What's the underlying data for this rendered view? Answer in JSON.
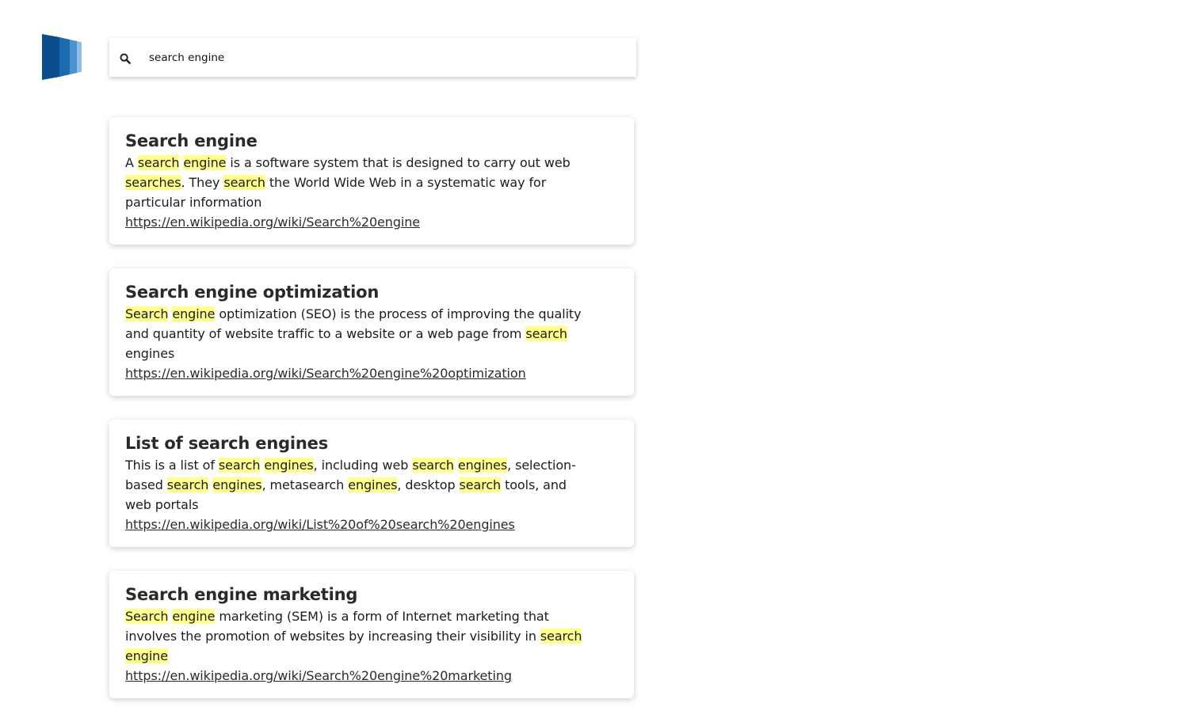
{
  "search": {
    "query": "search engine",
    "icon": "search-icon"
  },
  "logo": {
    "icon": "logo-icon",
    "colors": [
      "#0a4f8c",
      "#1b6bb0",
      "#4d92cc",
      "#8fbfe6"
    ]
  },
  "highlight_color": "#ffff8a",
  "results": [
    {
      "title": "Search engine",
      "snippet": [
        {
          "t": "A ",
          "h": false
        },
        {
          "t": "search",
          "h": true
        },
        {
          "t": " ",
          "h": false
        },
        {
          "t": "engine",
          "h": true
        },
        {
          "t": " is a software system that is designed to carry out web ",
          "h": false
        },
        {
          "t": "searches",
          "h": true
        },
        {
          "t": ". They ",
          "h": false
        },
        {
          "t": "search",
          "h": true
        },
        {
          "t": " the World Wide Web in a systematic way for particular information",
          "h": false
        }
      ],
      "url": "https://en.wikipedia.org/wiki/Search%20engine"
    },
    {
      "title": "Search engine optimization",
      "snippet": [
        {
          "t": "Search",
          "h": true
        },
        {
          "t": " ",
          "h": false
        },
        {
          "t": "engine",
          "h": true
        },
        {
          "t": " optimization (SEO) is the process of improving the quality and quantity of website traffic to a website or a web page from ",
          "h": false
        },
        {
          "t": "search",
          "h": true
        },
        {
          "t": " engines",
          "h": false
        }
      ],
      "url": "https://en.wikipedia.org/wiki/Search%20engine%20optimization"
    },
    {
      "title": "List of search engines",
      "snippet": [
        {
          "t": "This is a list of ",
          "h": false
        },
        {
          "t": "search",
          "h": true
        },
        {
          "t": " ",
          "h": false
        },
        {
          "t": "engines",
          "h": true
        },
        {
          "t": ", including web ",
          "h": false
        },
        {
          "t": "search",
          "h": true
        },
        {
          "t": " ",
          "h": false
        },
        {
          "t": "engines",
          "h": true
        },
        {
          "t": ", selection-based ",
          "h": false
        },
        {
          "t": "search",
          "h": true
        },
        {
          "t": " ",
          "h": false
        },
        {
          "t": "engines",
          "h": true
        },
        {
          "t": ", metasearch ",
          "h": false
        },
        {
          "t": "engines",
          "h": true
        },
        {
          "t": ", desktop ",
          "h": false
        },
        {
          "t": "search",
          "h": true
        },
        {
          "t": " tools, and web portals",
          "h": false
        }
      ],
      "url": "https://en.wikipedia.org/wiki/List%20of%20search%20engines"
    },
    {
      "title": "Search engine marketing",
      "snippet": [
        {
          "t": "Search",
          "h": true
        },
        {
          "t": " ",
          "h": false
        },
        {
          "t": "engine",
          "h": true
        },
        {
          "t": " marketing (SEM) is a form of Internet marketing that involves the promotion of websites by increasing their visibility in ",
          "h": false
        },
        {
          "t": "search",
          "h": true
        },
        {
          "t": " ",
          "h": false
        },
        {
          "t": "engine",
          "h": true
        }
      ],
      "url": "https://en.wikipedia.org/wiki/Search%20engine%20marketing"
    }
  ]
}
